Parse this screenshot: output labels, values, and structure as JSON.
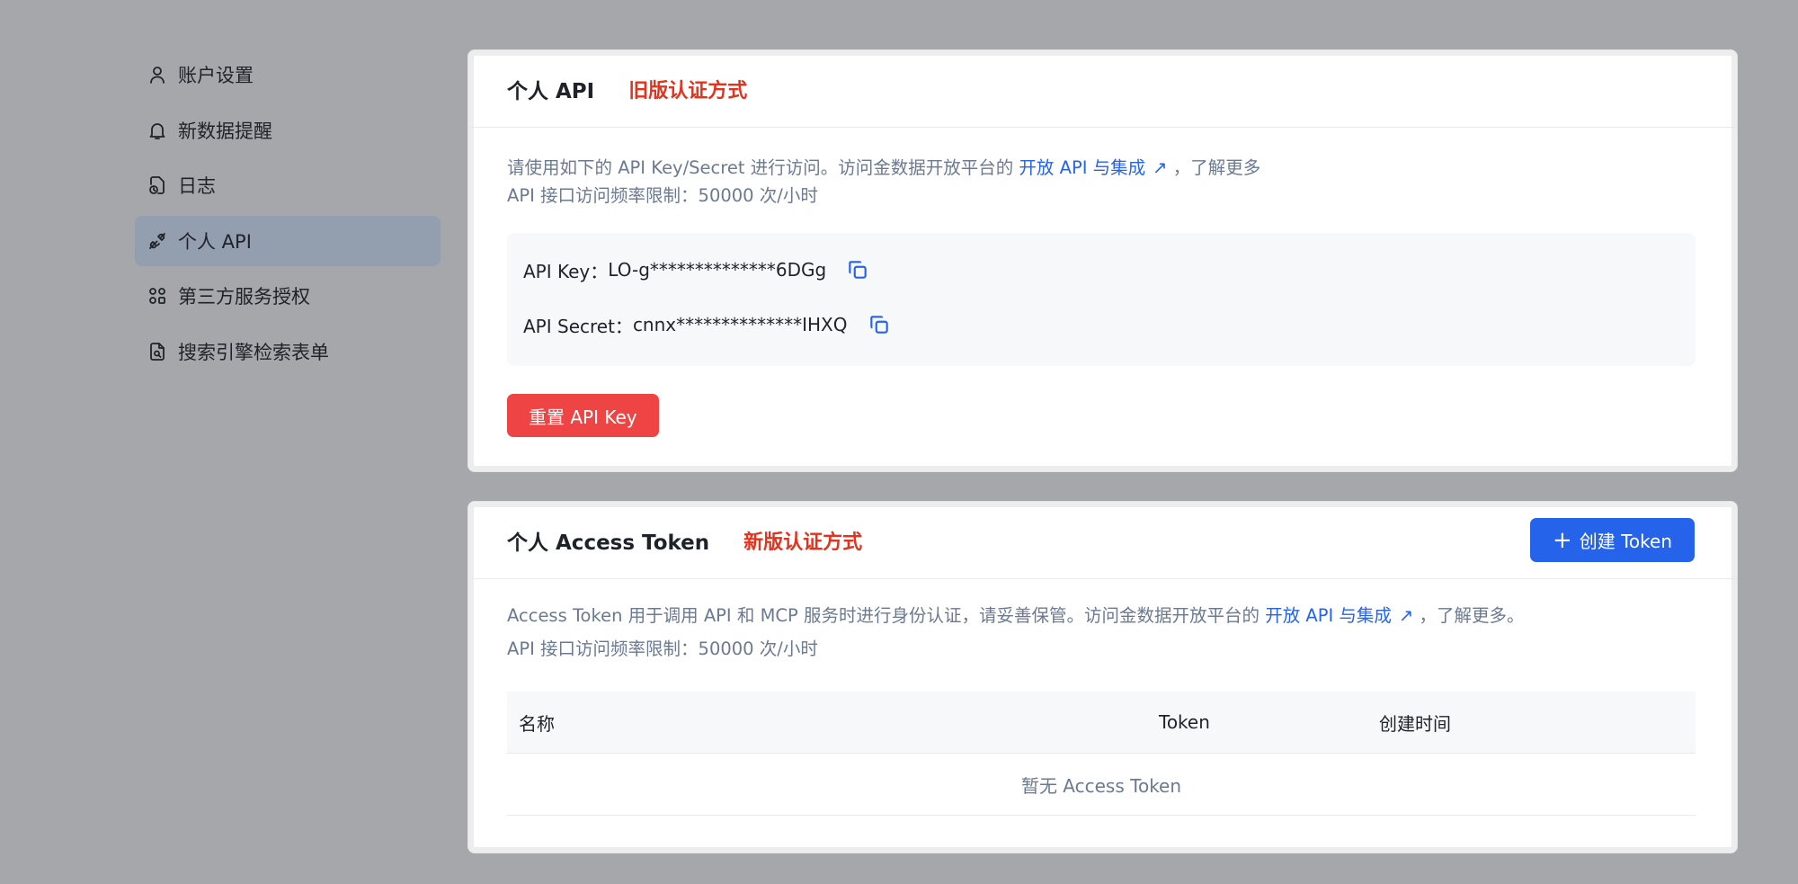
{
  "sidebar": {
    "items": [
      {
        "label": "账户设置",
        "icon": "user-icon"
      },
      {
        "label": "新数据提醒",
        "icon": "bell-icon"
      },
      {
        "label": "日志",
        "icon": "log-file-icon"
      },
      {
        "label": "个人 API",
        "icon": "api-plug-icon",
        "active": true
      },
      {
        "label": "第三方服务授权",
        "icon": "apps-grid-icon"
      },
      {
        "label": "搜索引擎检索表单",
        "icon": "search-document-icon"
      }
    ]
  },
  "api_card": {
    "title": "个人 API",
    "tag": "旧版认证方式",
    "desc_prefix": "请使用如下的 API Key/Secret 进行访问。访问金数据开放平台的",
    "desc_link": "开放 API 与集成",
    "desc_suffix": "，了解更多",
    "rate_limit": "API 接口访问频率限制：50000 次/小时",
    "key_label": "API Key：",
    "key_value": "LO-g**************6DGg",
    "secret_label": "API Secret：",
    "secret_value": "cnnx**************IHXQ",
    "reset_label": "重置 API Key"
  },
  "token_card": {
    "title": "个人 Access Token",
    "tag": "新版认证方式",
    "create_label": "创建 Token",
    "desc_prefix": "Access Token 用于调用 API 和 MCP 服务时进行身份认证，请妥善保管。访问金数据开放平台的",
    "desc_link": "开放 API 与集成",
    "desc_suffix": "，了解更多。",
    "rate_limit": "API 接口访问频率限制：50000 次/小时",
    "columns": [
      "名称",
      "Token",
      "创建时间"
    ],
    "empty_text": "暂无 Access Token"
  },
  "colors": {
    "accent": "#2563eb",
    "danger": "#ef4444",
    "tag_red": "#e3321e"
  }
}
